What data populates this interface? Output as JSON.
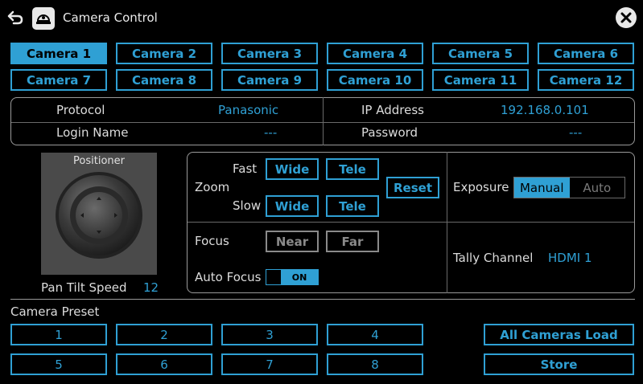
{
  "window": {
    "title": "Camera Control"
  },
  "icons": {
    "back": "back-arrow-icon",
    "app": "camera-icon",
    "close": "close-icon"
  },
  "cameras": [
    "Camera 1",
    "Camera 2",
    "Camera 3",
    "Camera 4",
    "Camera 5",
    "Camera 6",
    "Camera 7",
    "Camera 8",
    "Camera 9",
    "Camera 10",
    "Camera 11",
    "Camera 12"
  ],
  "selected_camera": "Camera 1",
  "info": {
    "protocol_label": "Protocol",
    "protocol_value": "Panasonic",
    "ip_label": "IP Address",
    "ip_value": "192.168.0.101",
    "login_label": "Login Name",
    "login_value": "---",
    "password_label": "Password",
    "password_value": "---"
  },
  "positioner": {
    "label": "Positioner",
    "speed_label": "Pan Tilt Speed",
    "speed_value": "12"
  },
  "zoom": {
    "label": "Zoom",
    "fast": "Fast",
    "slow": "Slow",
    "wide": "Wide",
    "tele": "Tele",
    "reset": "Reset"
  },
  "focus": {
    "label": "Focus",
    "near": "Near",
    "far": "Far",
    "auto_label": "Auto Focus",
    "auto_state": "ON"
  },
  "exposure": {
    "label": "Exposure",
    "manual": "Manual",
    "auto": "Auto",
    "selected": "Manual"
  },
  "tally": {
    "label": "Tally Channel",
    "value": "HDMI 1"
  },
  "preset": {
    "label": "Camera Preset",
    "buttons": [
      "1",
      "2",
      "3",
      "4",
      "5",
      "6",
      "7",
      "8"
    ],
    "load_all": "All Cameras Load",
    "store": "Store"
  },
  "colors": {
    "accent": "#2fa0d4",
    "background": "#000000",
    "panel_border": "#9a9a9a",
    "disabled": "#8a8a8a"
  }
}
